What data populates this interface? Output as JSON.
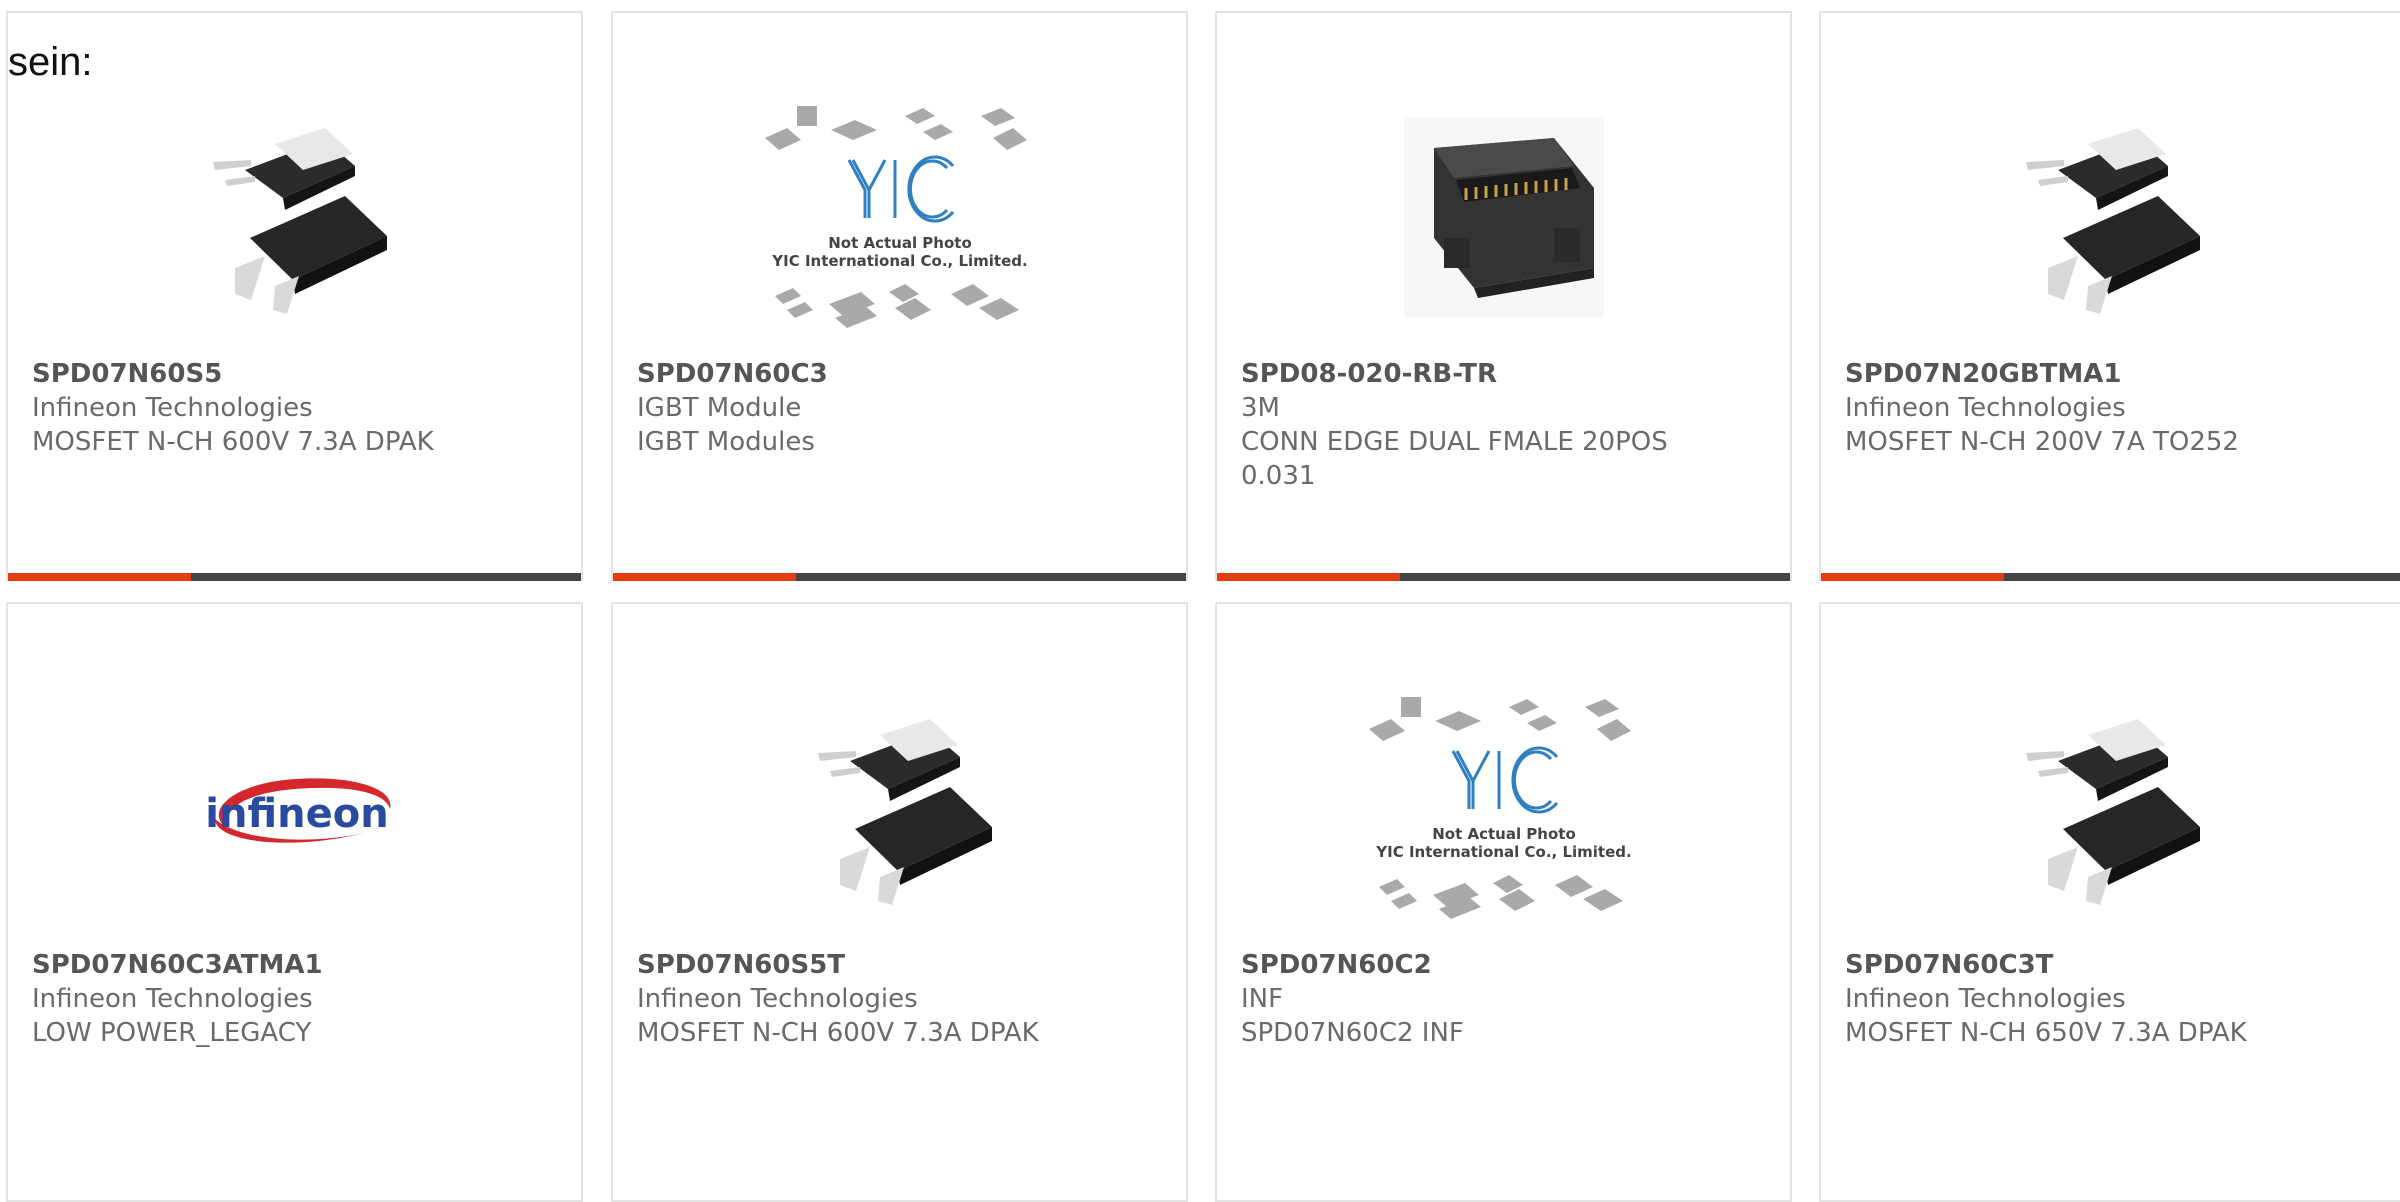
{
  "intro_text": "sein:",
  "colors": {
    "accent_bar": "#e43d12",
    "dark_bar": "#444444",
    "infineon_red": "#d4282d",
    "infineon_blue": "#2a4aa0",
    "yic_blue": "#2f7fc1"
  },
  "products": [
    {
      "part_number": "SPD07N60S5",
      "manufacturer": "Infineon Technologies",
      "description": "MOSFET N-CH 600V 7.3A DPAK",
      "image": "dpak-package-icon"
    },
    {
      "part_number": "SPD07N60C3",
      "manufacturer": "IGBT Module",
      "description": "IGBT Modules",
      "image": "yic-placeholder-icon",
      "placeholder_line1": "Not Actual Photo",
      "placeholder_line2": "YIC International Co., Limited."
    },
    {
      "part_number": "SPD08-020-RB-TR",
      "manufacturer": "3M",
      "description": "CONN EDGE DUAL FMALE 20POS",
      "description_line2": "0.031",
      "image": "edge-connector-icon"
    },
    {
      "part_number": "SPD07N20GBTMA1",
      "manufacturer": "Infineon Technologies",
      "description": "MOSFET N-CH 200V 7A TO252",
      "image": "dpak-package-icon"
    },
    {
      "part_number": "SPD07N60C3ATMA1",
      "manufacturer": "Infineon Technologies",
      "description": "LOW POWER_LEGACY",
      "image": "infineon-logo",
      "logo_text": "infineon"
    },
    {
      "part_number": "SPD07N60S5T",
      "manufacturer": "Infineon Technologies",
      "description": "MOSFET N-CH 600V 7.3A DPAK",
      "image": "dpak-package-icon"
    },
    {
      "part_number": "SPD07N60C2",
      "manufacturer": "INF",
      "description": "SPD07N60C2 INF",
      "image": "yic-placeholder-icon",
      "placeholder_line1": "Not Actual Photo",
      "placeholder_line2": "YIC International Co., Limited."
    },
    {
      "part_number": "SPD07N60C3T",
      "manufacturer": "Infineon Technologies",
      "description": "MOSFET N-CH 650V 7.3A DPAK",
      "image": "dpak-package-icon"
    }
  ]
}
